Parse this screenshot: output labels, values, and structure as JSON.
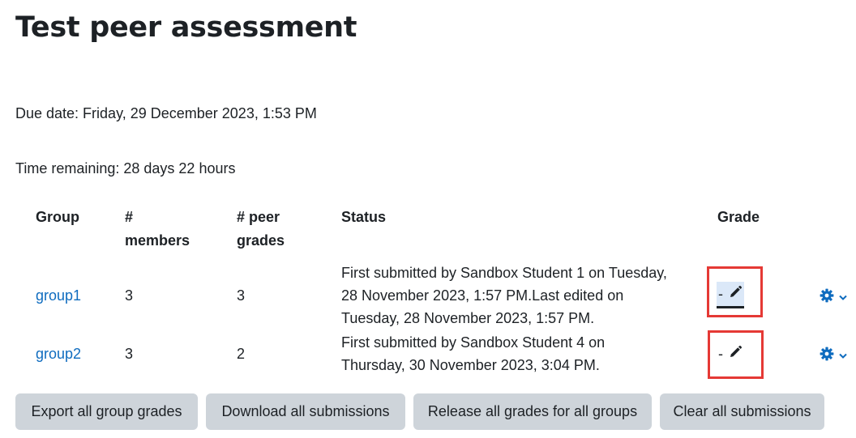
{
  "page": {
    "title": "Test peer assessment",
    "due_date": "Due date: Friday, 29 December 2023, 1:53 PM",
    "time_remaining": "Time remaining: 28 days 22 hours"
  },
  "table": {
    "headers": {
      "group": "Group",
      "members_l1": "#",
      "members_l2": "members",
      "peer_l1": "# peer",
      "peer_l2": "grades",
      "status": "Status",
      "grade": "Grade"
    },
    "rows": [
      {
        "group": "group1",
        "members": "3",
        "peer_grades": "3",
        "status_lines": [
          "First submitted by Sandbox Student 1 on Tuesday,",
          "28 November 2023, 1:57 PM.Last edited on",
          "Tuesday, 28 November 2023, 1:57 PM."
        ],
        "grade": "-"
      },
      {
        "group": "group2",
        "members": "3",
        "peer_grades": "2",
        "status_lines": [
          "First submitted by Sandbox Student 4 on",
          "Thursday, 30 November 2023, 3:04 PM."
        ],
        "grade": "-"
      }
    ]
  },
  "buttons": {
    "export": "Export all group grades",
    "download": "Download all submissions",
    "release": "Release all grades for all groups",
    "clear": "Clear all submissions"
  },
  "icons": {
    "edit": "pencil-icon",
    "actions": "gear-icon",
    "dropdown": "chevron-down-icon"
  },
  "colors": {
    "link": "#0f6cbf",
    "highlight_box": "#e53935",
    "button_bg": "#ced4da",
    "active_grade_bg": "#dbe8f8"
  }
}
